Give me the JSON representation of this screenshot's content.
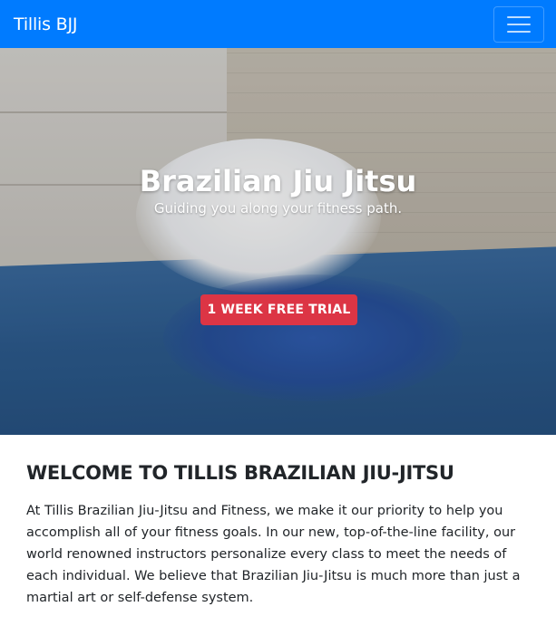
{
  "navbar": {
    "brand": "Tillis BJJ",
    "menu_icon": "hamburger-menu-icon",
    "color": "#007bff"
  },
  "hero": {
    "title": "Brazilian Jiu Jitsu",
    "subtitle": "Guiding you along your fitness path.",
    "cta_label": "1 WEEK FREE TRIAL",
    "cta_color": "#dc3545"
  },
  "main": {
    "heading": "WELCOME TO TILLIS BRAZILIAN JIU-JITSU",
    "paragraph": "At Tillis Brazilian Jiu-Jitsu and Fitness, we make it our priority to help you accomplish all of your fitness goals. In our new, top-of-the-line facility, our world renowned instructors personalize every class to meet the needs of each individual. We believe that Brazilian Jiu-Jitsu is much more than just a martial art or self-defense system."
  }
}
